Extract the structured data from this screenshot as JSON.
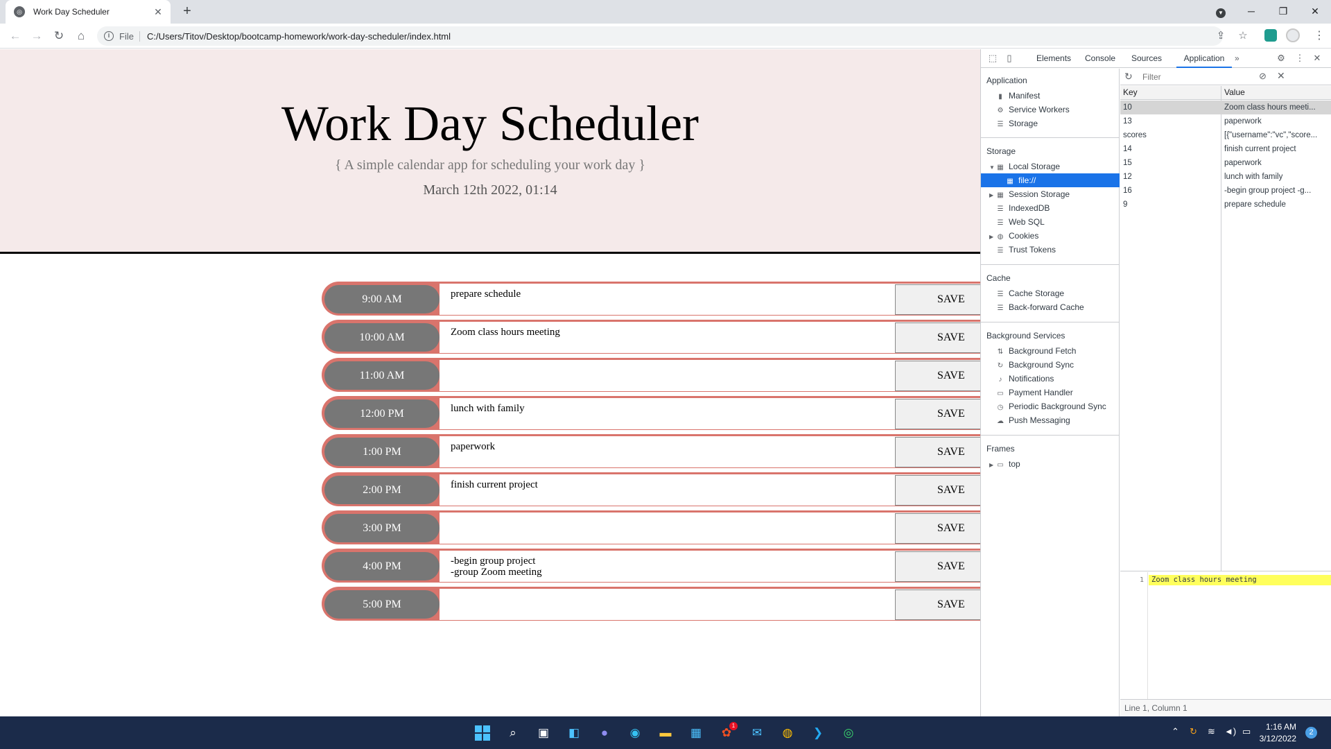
{
  "browser": {
    "tab_title": "Work Day Scheduler",
    "tab_close": "✕",
    "new_tab": "+",
    "scheme": "File",
    "url": "C:/Users/Titov/Desktop/bootcamp-homework/work-day-scheduler/index.html"
  },
  "page": {
    "title": "Work Day Scheduler",
    "lead": "{ A simple calendar app for scheduling your work day }",
    "date": "March 12th 2022, 01:14",
    "save_label": "SAVE",
    "hours": [
      {
        "time": "9:00 AM",
        "text": "prepare schedule"
      },
      {
        "time": "10:00 AM",
        "text": "Zoom class hours meeting"
      },
      {
        "time": "11:00 AM",
        "text": ""
      },
      {
        "time": "12:00 PM",
        "text": "lunch with family"
      },
      {
        "time": "1:00 PM",
        "text": "paperwork"
      },
      {
        "time": "2:00 PM",
        "text": "finish current project"
      },
      {
        "time": "3:00 PM",
        "text": ""
      },
      {
        "time": "4:00 PM",
        "text": "-begin group project\n-group Zoom meeting"
      },
      {
        "time": "5:00 PM",
        "text": ""
      }
    ]
  },
  "devtools": {
    "tabs": [
      "Elements",
      "Console",
      "Sources",
      "Application"
    ],
    "active_tab": "Application",
    "more_tabs": "»",
    "sections": {
      "application": {
        "title": "Application",
        "items": [
          "Manifest",
          "Service Workers",
          "Storage"
        ]
      },
      "storage": {
        "title": "Storage",
        "items": [
          "Local Storage",
          "file://",
          "Session Storage",
          "IndexedDB",
          "Web SQL",
          "Cookies",
          "Trust Tokens"
        ]
      },
      "cache": {
        "title": "Cache",
        "items": [
          "Cache Storage",
          "Back-forward Cache"
        ]
      },
      "background": {
        "title": "Background Services",
        "items": [
          "Background Fetch",
          "Background Sync",
          "Notifications",
          "Payment Handler",
          "Periodic Background Sync",
          "Push Messaging"
        ]
      },
      "frames": {
        "title": "Frames",
        "items": [
          "top"
        ]
      }
    },
    "filter_placeholder": "Filter",
    "table": {
      "key_header": "Key",
      "value_header": "Value",
      "rows": [
        {
          "key": "10",
          "value": "Zoom class hours meeti..."
        },
        {
          "key": "13",
          "value": "paperwork"
        },
        {
          "key": "scores",
          "value": "[{\"username\":\"vc\",\"score..."
        },
        {
          "key": "14",
          "value": "finish current project"
        },
        {
          "key": "15",
          "value": "paperwork"
        },
        {
          "key": "12",
          "value": "lunch with family"
        },
        {
          "key": "16",
          "value": "-begin group project -g..."
        },
        {
          "key": "9",
          "value": "prepare schedule"
        }
      ]
    },
    "preview": {
      "line_number": "1",
      "line_text": "Zoom class hours meeting"
    },
    "status": "Line 1, Column 1"
  },
  "taskbar": {
    "time": "1:16 AM",
    "date": "3/12/2022",
    "notification_count": "2",
    "store_badge": "1"
  }
}
